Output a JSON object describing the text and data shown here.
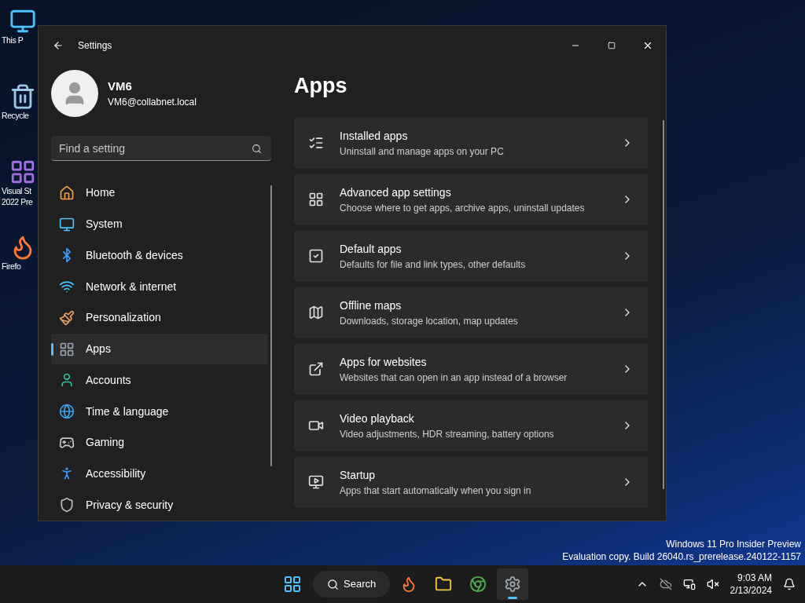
{
  "desktop": {
    "icons": [
      {
        "lines": [
          "This P"
        ]
      },
      {
        "lines": [
          "Recycle"
        ]
      },
      {
        "lines": [
          "Visual St",
          "2022 Pre"
        ]
      },
      {
        "lines": [
          "Firefo"
        ]
      }
    ],
    "watermark": [
      "Windows 11 Pro Insider Preview",
      "Evaluation copy. Build 26040.rs_prerelease.240122-1157"
    ]
  },
  "window": {
    "title": "Settings",
    "user": {
      "name": "VM6",
      "email": "VM6@collabnet.local"
    },
    "search": {
      "placeholder": "Find a setting"
    },
    "nav": [
      {
        "label": "Home",
        "selected": false
      },
      {
        "label": "System",
        "selected": false
      },
      {
        "label": "Bluetooth & devices",
        "selected": false
      },
      {
        "label": "Network & internet",
        "selected": false
      },
      {
        "label": "Personalization",
        "selected": false
      },
      {
        "label": "Apps",
        "selected": true
      },
      {
        "label": "Accounts",
        "selected": false
      },
      {
        "label": "Time & language",
        "selected": false
      },
      {
        "label": "Gaming",
        "selected": false
      },
      {
        "label": "Accessibility",
        "selected": false
      },
      {
        "label": "Privacy & security",
        "selected": false
      }
    ],
    "page_title": "Apps",
    "cards": [
      {
        "title": "Installed apps",
        "subtitle": "Uninstall and manage apps on your PC"
      },
      {
        "title": "Advanced app settings",
        "subtitle": "Choose where to get apps, archive apps, uninstall updates"
      },
      {
        "title": "Default apps",
        "subtitle": "Defaults for file and link types, other defaults"
      },
      {
        "title": "Offline maps",
        "subtitle": "Downloads, storage location, map updates"
      },
      {
        "title": "Apps for websites",
        "subtitle": "Websites that can open in an app instead of a browser"
      },
      {
        "title": "Video playback",
        "subtitle": "Video adjustments, HDR streaming, battery options"
      },
      {
        "title": "Startup",
        "subtitle": "Apps that start automatically when you sign in"
      }
    ]
  },
  "taskbar": {
    "search_label": "Search",
    "apps": [
      {
        "selected": false
      },
      {
        "selected": false
      },
      {
        "selected": false
      },
      {
        "selected": true
      }
    ],
    "time": "9:03 AM",
    "date": "2/13/2024"
  }
}
